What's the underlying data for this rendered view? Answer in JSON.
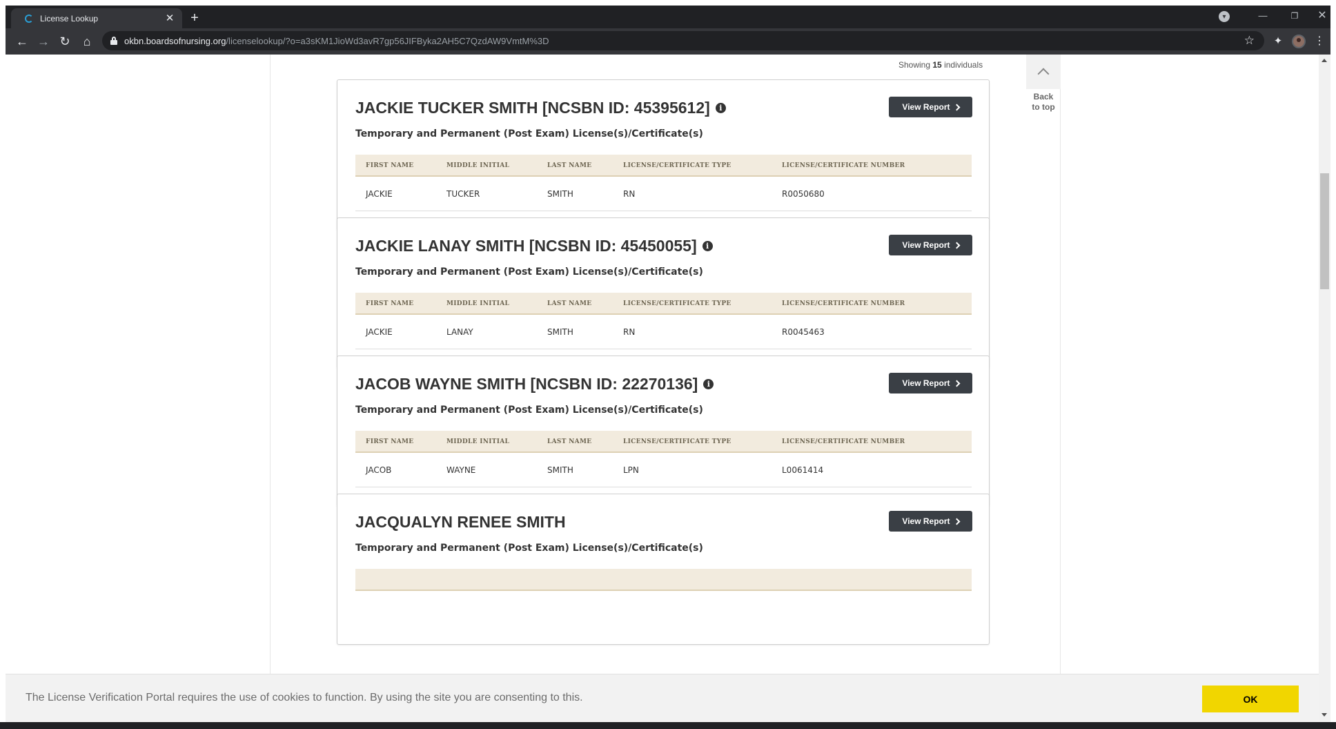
{
  "browser": {
    "tab_title": "License Lookup",
    "tab_close": "✕",
    "new_tab": "+",
    "url_host": "okbn.boardsofnursing.org",
    "url_path": "/licenselookup/?o=a3sKM1JioWd3avR7gp56JIFByka2AH5C7QzdAW9VmtM%3D",
    "icons": [
      "back-icon",
      "forward-icon",
      "reload-icon",
      "home-icon",
      "lock-icon",
      "star-icon",
      "extensions-icon",
      "avatar",
      "menu-icon",
      "minimize-icon",
      "restore-icon",
      "close-icon"
    ]
  },
  "results": {
    "showing_prefix": "Showing",
    "count": "15",
    "showing_suffix": "individuals"
  },
  "back_to_top": {
    "line1": "Back",
    "line2": "to top"
  },
  "table_headers": [
    "FIRST NAME",
    "MIDDLE INITIAL",
    "LAST NAME",
    "LICENSE/CERTIFICATE TYPE",
    "LICENSE/CERTIFICATE NUMBER"
  ],
  "cards": [
    {
      "title": "JACKIE TUCKER SMITH [NCSBN ID: 45395612]",
      "has_info_icon": true,
      "subtitle": "Temporary and Permanent (Post Exam) License(s)/Certificate(s)",
      "button": "View Report",
      "row": [
        "JACKIE",
        "TUCKER",
        "SMITH",
        "RN",
        "R0050680"
      ]
    },
    {
      "title": "JACKIE LANAY SMITH [NCSBN ID: 45450055]",
      "has_info_icon": true,
      "subtitle": "Temporary and Permanent (Post Exam) License(s)/Certificate(s)",
      "button": "View Report",
      "row": [
        "JACKIE",
        "LANAY",
        "SMITH",
        "RN",
        "R0045463"
      ]
    },
    {
      "title": "JACOB WAYNE SMITH [NCSBN ID: 22270136]",
      "has_info_icon": true,
      "subtitle": "Temporary and Permanent (Post Exam) License(s)/Certificate(s)",
      "button": "View Report",
      "row": [
        "JACOB",
        "WAYNE",
        "SMITH",
        "LPN",
        "L0061414"
      ]
    },
    {
      "title": "JACQUALYN RENEE SMITH",
      "has_info_icon": false,
      "subtitle": "Temporary and Permanent (Post Exam) License(s)/Certificate(s)",
      "button": "View Report",
      "row": []
    }
  ],
  "cookie_banner": {
    "text": "The License Verification Portal requires the use of cookies to function. By using the site you are consenting to this.",
    "ok_label": "OK"
  },
  "colors": {
    "chrome_dark": "#202124",
    "toolbar": "#35363a",
    "button_dark": "#3a3f45",
    "table_header_bg": "#f2ebde",
    "cookie_ok": "#f1d600"
  }
}
